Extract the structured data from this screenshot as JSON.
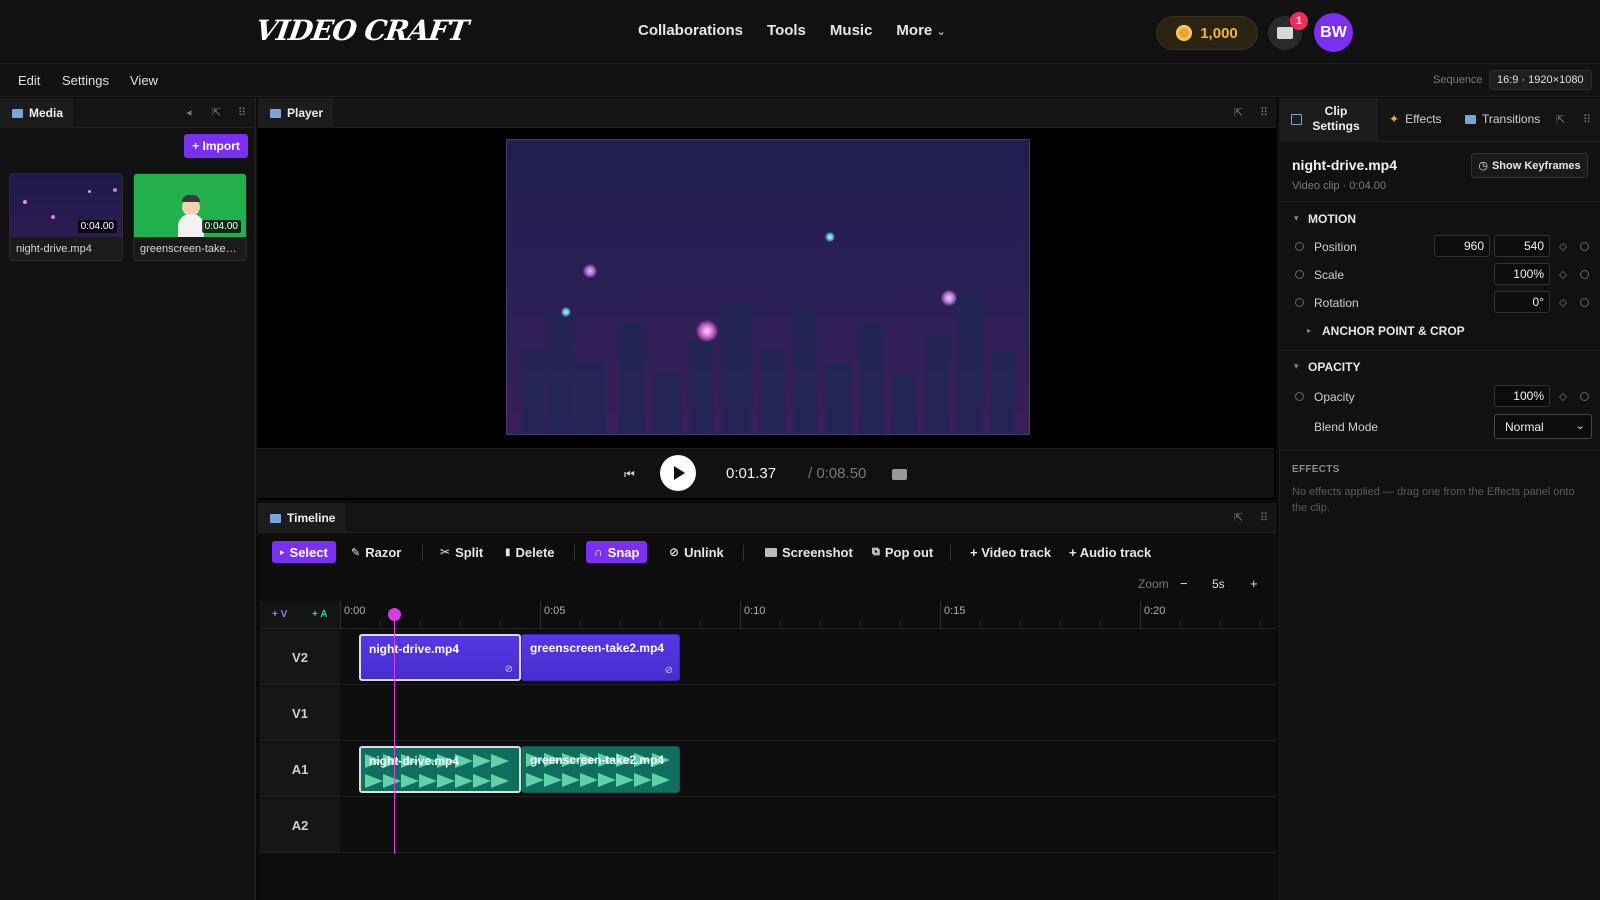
{
  "app": {
    "logo": "VIDEO CRAFT"
  },
  "nav": {
    "items": [
      "Collaborations",
      "Tools",
      "Music"
    ],
    "more": "More",
    "more_chevron": "⌄"
  },
  "account": {
    "coins": "1,000",
    "notifications": "1",
    "initials": "BW"
  },
  "menubar": {
    "items": [
      "Edit",
      "Settings",
      "View"
    ],
    "sequence_label": "Sequence",
    "sequence_value": "16:9 · 1920×1080"
  },
  "media": {
    "tab": "Media",
    "import_label": "+ Import",
    "items": [
      {
        "name": "night-drive.mp4",
        "duration": "0:04.00"
      },
      {
        "name": "greenscreen-take…",
        "duration": "0:04.00"
      }
    ]
  },
  "player": {
    "tab": "Player",
    "current_time": "0:01.37",
    "total_time": "/ 0:08.50"
  },
  "timeline": {
    "tab": "Timeline",
    "tools": {
      "select": "Select",
      "razor": "Razor",
      "split": "Split",
      "delete": "Delete",
      "snap": "Snap",
      "unlink": "Unlink",
      "screenshot": "Screenshot",
      "popout": "Pop out",
      "add_video": "+ Video track",
      "add_audio": "+ Audio track"
    },
    "zoom_label": "Zoom",
    "zoom_minus": "−",
    "zoom_value": "5s",
    "zoom_plus": "+",
    "add_v": "+ V",
    "add_a": "+ A",
    "ruler": [
      "0:00",
      "0:05",
      "0:10",
      "0:15",
      "0:20"
    ],
    "tracks": [
      "V2",
      "V1",
      "A1",
      "A2"
    ],
    "clips": {
      "v2_a": "night-drive.mp4",
      "v2_b": "greenscreen-take2.mp4",
      "a1_a": "night-drive.mp4",
      "a1_b": "greenscreen-take2.mp4"
    }
  },
  "inspector": {
    "tabs": {
      "clip_settings": "Clip Settings",
      "effects": "Effects",
      "transitions": "Transitions"
    },
    "clip_name": "night-drive.mp4",
    "clip_meta": "Video clip · 0:04.00",
    "show_keyframes": "Show Keyframes",
    "motion": {
      "title": "MOTION",
      "position_label": "Position",
      "position_x": "960",
      "position_y": "540",
      "scale_label": "Scale",
      "scale": "100%",
      "rotation_label": "Rotation",
      "rotation": "0°",
      "anchor_label": "ANCHOR POINT & CROP"
    },
    "opacity": {
      "title": "OPACITY",
      "opacity_label": "Opacity",
      "opacity": "100%",
      "blend_label": "Blend Mode",
      "blend": "Normal"
    },
    "effects": {
      "title": "EFFECTS",
      "empty": "No effects applied — drag one from the Effects panel onto the clip."
    }
  },
  "colors": {
    "accent": "#7b2ff2",
    "video_clip": "#5536e6",
    "audio_clip": "#0f6e5e",
    "playhead": "#e040e8",
    "coin": "#f0b53a"
  }
}
